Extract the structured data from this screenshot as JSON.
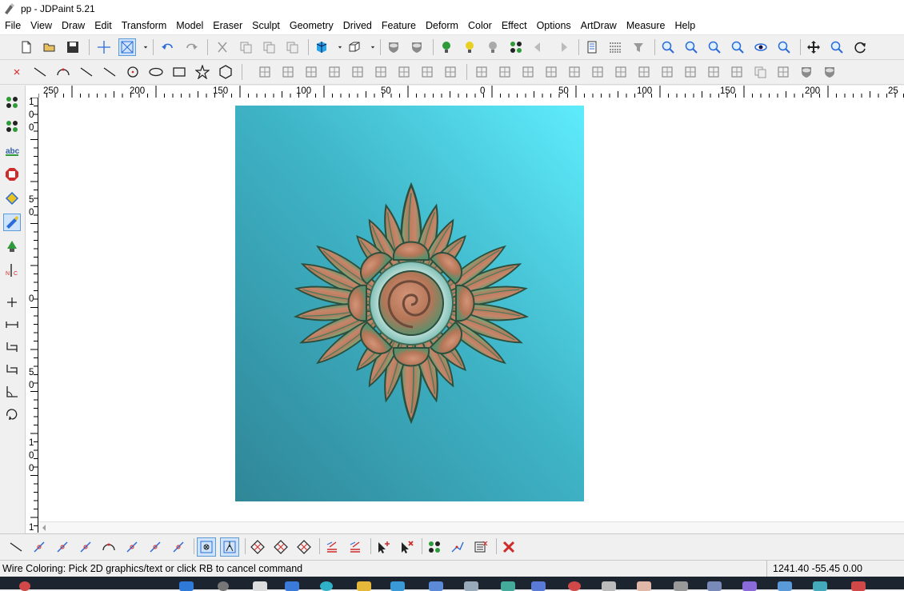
{
  "window": {
    "title": "pp - JDPaint 5.21"
  },
  "menu": [
    "File",
    "View",
    "Draw",
    "Edit",
    "Transform",
    "Model",
    "Eraser",
    "Sculpt",
    "Geometry",
    "Drived",
    "Feature",
    "Deform",
    "Color",
    "Effect",
    "Options",
    "ArtDraw",
    "Measure",
    "Help"
  ],
  "toolbar1": [
    "new-file-icon",
    "open-folder-icon",
    "save-icon",
    "crosshair-icon",
    "select-box-icon",
    "dropdown-arrow-icon",
    "undo-icon",
    "redo-icon",
    "cut-icon",
    "copy-icon",
    "paste-icon",
    "paste-special-icon",
    "color-cube-icon",
    "dropdown-arrow-icon",
    "view-3d-icon",
    "dropdown-arrow-icon",
    "shade-gray-icon",
    "shade-solid-icon",
    "light-green-icon",
    "light-yellow-icon",
    "light-gray-icon",
    "node-icon",
    "arrow-left-icon",
    "arrow-right-icon",
    "layers-icon",
    "grid-lines-icon",
    "gear-filter-icon",
    "zoom-window-icon",
    "zoom-out-icon",
    "zoom-in-icon",
    "zoom-previous-icon",
    "eye-icon",
    "zoom-all-icon",
    "pan-icon",
    "zoom-real-icon",
    "refresh-icon"
  ],
  "toolbar2": [
    "point-x-icon",
    "line-icon",
    "arc-icon",
    "spline-icon",
    "polyline-icon",
    "circle-dot-icon",
    "ellipse-icon",
    "rectangle-icon",
    "star-icon",
    "polygon-icon",
    "trim-icon",
    "extend-icon",
    "fillet-icon",
    "chamfer-icon",
    "offset-icon",
    "array-icon",
    "slot-icon",
    "emboss-frame-icon",
    "nest-icon",
    "group-icon",
    "align-icon",
    "distribute-icon",
    "gear-shape-icon",
    "parallelogram-icon",
    "pipe-icon",
    "dots-grid-icon",
    "wave-icon",
    "hatch-icon",
    "spiral-icon",
    "mesh-icon",
    "grid-icon",
    "copy-array-icon",
    "clone-icon",
    "half-shade-icon",
    "shield-icon"
  ],
  "lefttools": [
    "select-node-icon",
    "edit-node-icon",
    "text-abc-icon",
    "stop-sign-icon",
    "color-fill-icon",
    "brush-icon",
    "light-bulb-icon",
    "nc-icon",
    "plus-icon",
    "measure-distance-icon",
    "dimension-icon",
    "box-dimension-icon",
    "angle-icon",
    "rotate-icon"
  ],
  "bottomtools": [
    "snap-line-icon",
    "snap-intersect-icon",
    "snap-corner-icon",
    "snap-cross-icon",
    "snap-arc-icon",
    "snap-circle-icon",
    "snap-perpendicular-icon",
    "snap-tangent-icon",
    "snap-center-icon",
    "snap-axis-icon",
    "diamond-grid-a-icon",
    "diamond-grid-b-icon",
    "diamond-grid-c-icon",
    "stack-lines-icon",
    "stack-lines-edit-icon",
    "pick-cursor-icon",
    "pick-cursor-remove-icon",
    "transform-node-icon",
    "edit-path-icon",
    "select-list-icon",
    "delete-x-icon"
  ],
  "ruler": {
    "h_labels": [
      "250",
      "200",
      "150",
      "100",
      "50",
      "0",
      "50",
      "100",
      "150",
      "200",
      "25"
    ],
    "v_labels": [
      "1",
      "0",
      "0",
      "5",
      "0",
      "0",
      "5",
      "0",
      "1",
      "0",
      "0",
      "1"
    ]
  },
  "status": {
    "message": "Wire Coloring: Pick 2D graphics/text or click RB to cancel command",
    "coords": "1241.40 -55.45 0.00"
  },
  "colors": {
    "relief_bg_top": "#5ee9fb",
    "relief_bg_bottom": "#338f9e",
    "petal_copper": "#b07458",
    "petal_green": "#6fa878"
  }
}
